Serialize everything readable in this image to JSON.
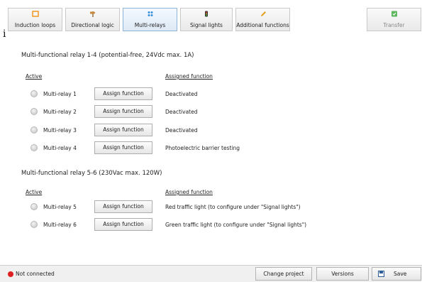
{
  "toolbar": {
    "tabs": [
      {
        "label": "Induction loops",
        "icon": "induction-loop-icon",
        "icon_color": "#f08a00"
      },
      {
        "label": "Directional logic",
        "icon": "direction-sign-icon",
        "icon_color": "#b07a3a"
      },
      {
        "label": "Multi-relays",
        "icon": "relay-icon",
        "icon_color": "#3a8fd8"
      },
      {
        "label": "Signal lights",
        "icon": "traffic-light-icon",
        "icon_color": "#333333"
      },
      {
        "label": "Additional functions",
        "icon": "pencil-icon",
        "icon_color": "#e0a020"
      }
    ],
    "transfer_label": "Transfer",
    "transfer_icon_color": "#4caf50"
  },
  "cursor_glyph": "i",
  "section1": {
    "title": "Multi-functional relay 1-4 (potential-free, 24Vdc max. 1A)",
    "col_active": "Active",
    "col_function": "Assigned function",
    "rows": [
      {
        "name": "Multi-relay 1",
        "button": "Assign function",
        "function": "Deactivated"
      },
      {
        "name": "Multi-relay 2",
        "button": "Assign function",
        "function": "Deactivated"
      },
      {
        "name": "Multi-relay 3",
        "button": "Assign function",
        "function": "Deactivated"
      },
      {
        "name": "Multi-relay 4",
        "button": "Assign function",
        "function": "Photoelectric barrier testing"
      }
    ]
  },
  "section2": {
    "title": "Multi-functional relay 5-6 (230Vac max. 120W)",
    "col_active": "Active",
    "col_function": "Assigned function",
    "rows": [
      {
        "name": "Multi-relay 5",
        "button": "Assign function",
        "function": "Red traffic light (to configure under \"Signal lights\")"
      },
      {
        "name": "Multi-relay 6",
        "button": "Assign function",
        "function": "Green traffic light (to configure under \"Signal lights\")"
      }
    ]
  },
  "statusbar": {
    "status_text": "Not connected",
    "status_color": "#e02020",
    "change_project": "Change project",
    "versions": "Versions",
    "save": "Save"
  }
}
